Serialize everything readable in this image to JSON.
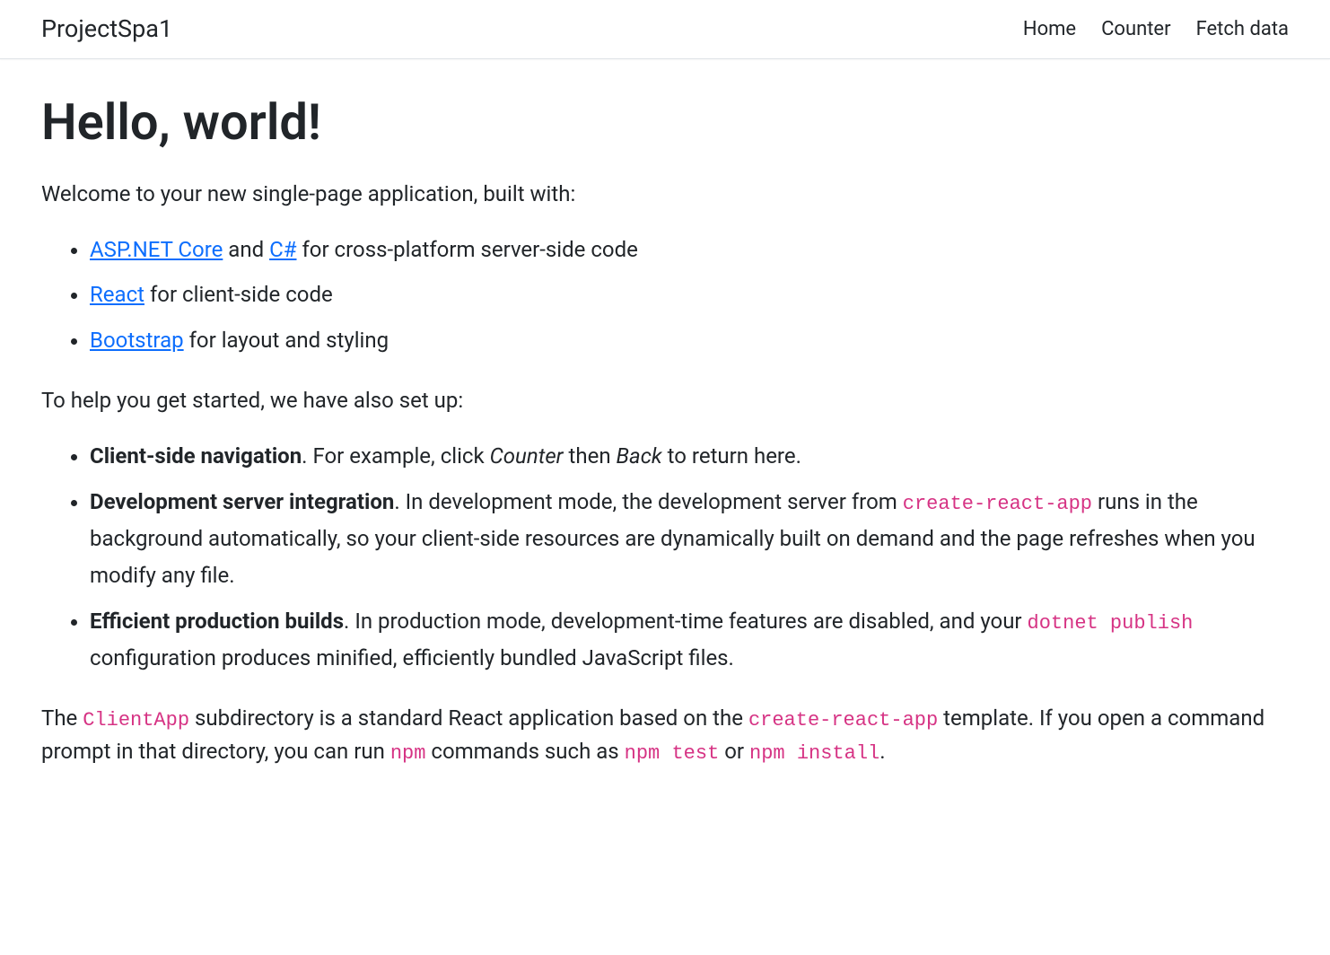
{
  "navbar": {
    "brand": "ProjectSpa1",
    "links": [
      {
        "label": "Home"
      },
      {
        "label": "Counter"
      },
      {
        "label": "Fetch data"
      }
    ]
  },
  "main": {
    "heading": "Hello, world!",
    "welcome": "Welcome to your new single-page application, built with:",
    "tech_list": {
      "item1": {
        "link1": "ASP.NET Core",
        "text1": " and ",
        "link2": "C#",
        "text2": " for cross-platform server-side code"
      },
      "item2": {
        "link1": "React",
        "text1": " for client-side code"
      },
      "item3": {
        "link1": "Bootstrap",
        "text1": " for layout and styling"
      }
    },
    "setup_intro": "To help you get started, we have also set up:",
    "setup_list": {
      "item1": {
        "bold": "Client-side navigation",
        "text1": ". For example, click ",
        "em1": "Counter",
        "text2": " then ",
        "em2": "Back",
        "text3": " to return here."
      },
      "item2": {
        "bold": "Development server integration",
        "text1": ". In development mode, the development server from ",
        "code1": "create-react-app",
        "text2": " runs in the background automatically, so your client-side resources are dynamically built on demand and the page refreshes when you modify any file."
      },
      "item3": {
        "bold": "Efficient production builds",
        "text1": ". In production mode, development-time features are disabled, and your ",
        "code1": "dotnet publish",
        "text2": " configuration produces minified, efficiently bundled JavaScript files."
      }
    },
    "footer": {
      "text1": "The ",
      "code1": "ClientApp",
      "text2": " subdirectory is a standard React application based on the ",
      "code2": "create-react-app",
      "text3": " template. If you open a command prompt in that directory, you can run ",
      "code3": "npm",
      "text4": " commands such as ",
      "code4": "npm test",
      "text5": " or ",
      "code5": "npm install",
      "text6": "."
    }
  }
}
